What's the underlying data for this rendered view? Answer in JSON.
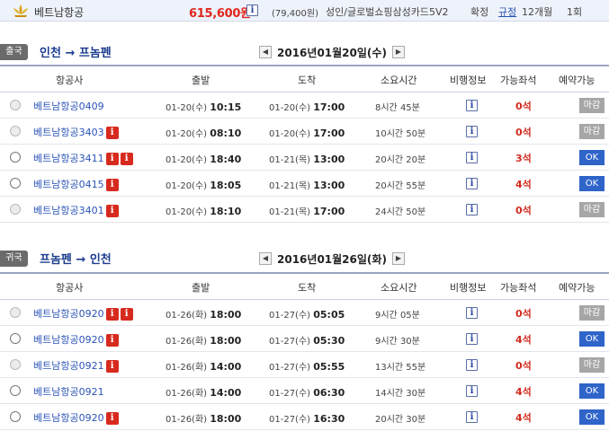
{
  "header": {
    "airline": "베트남항공",
    "price": "615,600원",
    "sub_price": "(79,400원)",
    "card": "성인/글로벌쇼핑삼성카드5V2",
    "confirm": "확정",
    "rule": "규정",
    "months": "12개월",
    "times": "1회",
    "colors": {
      "price": "#e1261c",
      "link": "#2b54b7"
    }
  },
  "outbound": {
    "tag": "출국",
    "route": "인천 → 프놈펜",
    "date": "2016년01월20일(수)",
    "columns": [
      "항공사",
      "출발",
      "도착",
      "소요시간",
      "비행정보",
      "가능좌석",
      "예약가능"
    ],
    "rows": [
      {
        "flight": "베트남항공0409",
        "red_icons": 0,
        "dep_date": "01-20(수)",
        "dep_time": "10:15",
        "arr_date": "01-20(수)",
        "arr_time": "17:00",
        "duration": "8시간 45분",
        "seats": "0석",
        "status": "마감",
        "enabled": false
      },
      {
        "flight": "베트남항공3403",
        "red_icons": 1,
        "dep_date": "01-20(수)",
        "dep_time": "08:10",
        "arr_date": "01-20(수)",
        "arr_time": "17:00",
        "duration": "10시간 50분",
        "seats": "0석",
        "status": "마감",
        "enabled": false
      },
      {
        "flight": "베트남항공3411",
        "red_icons": 2,
        "dep_date": "01-20(수)",
        "dep_time": "18:40",
        "arr_date": "01-21(목)",
        "arr_time": "13:00",
        "duration": "20시간 20분",
        "seats": "3석",
        "status": "OK",
        "enabled": true
      },
      {
        "flight": "베트남항공0415",
        "red_icons": 1,
        "dep_date": "01-20(수)",
        "dep_time": "18:05",
        "arr_date": "01-21(목)",
        "arr_time": "13:00",
        "duration": "20시간 55분",
        "seats": "4석",
        "status": "OK",
        "enabled": true
      },
      {
        "flight": "베트남항공3401",
        "red_icons": 1,
        "dep_date": "01-20(수)",
        "dep_time": "18:10",
        "arr_date": "01-21(목)",
        "arr_time": "17:00",
        "duration": "24시간 50분",
        "seats": "0석",
        "status": "마감",
        "enabled": false
      }
    ]
  },
  "inbound": {
    "tag": "귀국",
    "route": "프놈펜 → 인천",
    "date": "2016년01월26일(화)",
    "columns": [
      "항공사",
      "출발",
      "도착",
      "소요시간",
      "비행정보",
      "가능좌석",
      "예약가능"
    ],
    "rows": [
      {
        "flight": "베트남항공0920",
        "red_icons": 2,
        "dep_date": "01-26(화)",
        "dep_time": "18:00",
        "arr_date": "01-27(수)",
        "arr_time": "05:05",
        "duration": "9시간 05분",
        "seats": "0석",
        "status": "마감",
        "enabled": false
      },
      {
        "flight": "베트남항공0920",
        "red_icons": 1,
        "dep_date": "01-26(화)",
        "dep_time": "18:00",
        "arr_date": "01-27(수)",
        "arr_time": "05:30",
        "duration": "9시간 30분",
        "seats": "4석",
        "status": "OK",
        "enabled": true
      },
      {
        "flight": "베트남항공0921",
        "red_icons": 1,
        "dep_date": "01-26(화)",
        "dep_time": "14:00",
        "arr_date": "01-27(수)",
        "arr_time": "05:55",
        "duration": "13시간 55분",
        "seats": "0석",
        "status": "마감",
        "enabled": false
      },
      {
        "flight": "베트남항공0921",
        "red_icons": 0,
        "dep_date": "01-26(화)",
        "dep_time": "14:00",
        "arr_date": "01-27(수)",
        "arr_time": "06:30",
        "duration": "14시간 30분",
        "seats": "4석",
        "status": "OK",
        "enabled": true
      },
      {
        "flight": "베트남항공0920",
        "red_icons": 1,
        "dep_date": "01-26(화)",
        "dep_time": "18:00",
        "arr_date": "01-27(수)",
        "arr_time": "16:30",
        "duration": "20시간 30분",
        "seats": "4석",
        "status": "OK",
        "enabled": true
      }
    ]
  },
  "icons": {
    "info": "i",
    "prev": "◀",
    "next": "▶",
    "logo": "lotus-logo-icon"
  }
}
